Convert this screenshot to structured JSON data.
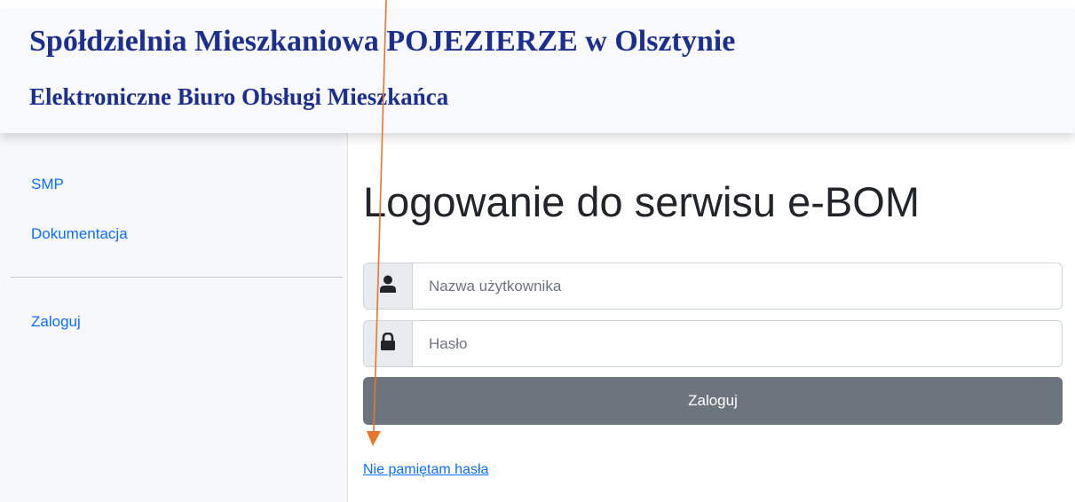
{
  "header": {
    "title": "Spółdzielnia Mieszkaniowa POJEZIERZE w Olsztynie",
    "subtitle": "Elektroniczne Biuro Obsługi Mieszkańca"
  },
  "sidebar": {
    "items": [
      {
        "label": "SMP"
      },
      {
        "label": "Dokumentacja"
      },
      {
        "label": "Zaloguj"
      }
    ]
  },
  "main": {
    "title": "Logowanie do serwisu e-BOM",
    "username": {
      "placeholder": "Nazwa użytkownika",
      "icon": "user-icon"
    },
    "password": {
      "placeholder": "Hasło",
      "icon": "lock-icon"
    },
    "login_button": "Zaloguj",
    "forgot_password": "Nie pamiętam hasła"
  },
  "annotation": {
    "arrow_color": "#e8762d"
  },
  "colors": {
    "brand": "#1c2f8f",
    "link": "#0d6efd",
    "button": "#6c757d"
  }
}
